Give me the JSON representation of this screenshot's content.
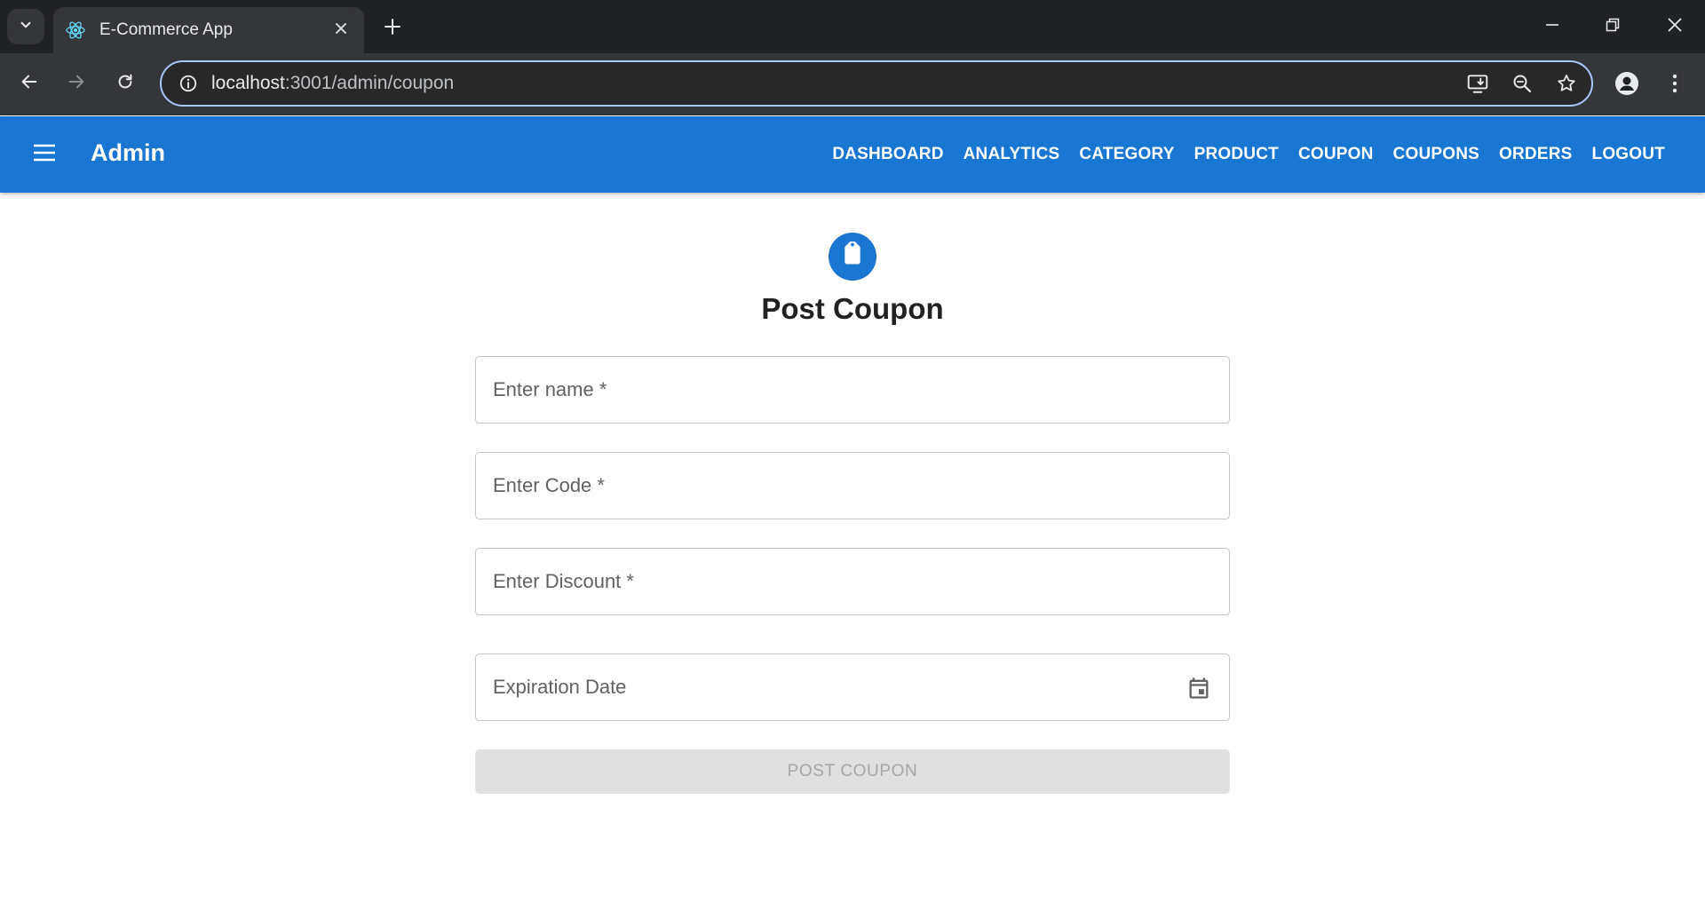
{
  "browser": {
    "tab": {
      "title": "E-Commerce App",
      "favicon": "react-logo-icon"
    },
    "omnibox": {
      "host": "localhost",
      "path": ":3001/admin/coupon"
    }
  },
  "appbar": {
    "title": "Admin",
    "nav": [
      {
        "label": "DASHBOARD"
      },
      {
        "label": "ANALYTICS"
      },
      {
        "label": "CATEGORY"
      },
      {
        "label": "PRODUCT"
      },
      {
        "label": "COUPON"
      },
      {
        "label": "COUPONS"
      },
      {
        "label": "ORDERS"
      },
      {
        "label": "LOGOUT"
      }
    ],
    "color": "#1976d2"
  },
  "form": {
    "icon": "tag-icon",
    "title": "Post Coupon",
    "fields": {
      "name": {
        "label": "Enter name *",
        "value": ""
      },
      "code": {
        "label": "Enter Code *",
        "value": ""
      },
      "discount": {
        "label": "Enter Discount *",
        "value": ""
      },
      "expiration": {
        "label": "Expiration Date",
        "value": ""
      }
    },
    "submit_label": "POST COUPON",
    "submit_disabled": true
  }
}
